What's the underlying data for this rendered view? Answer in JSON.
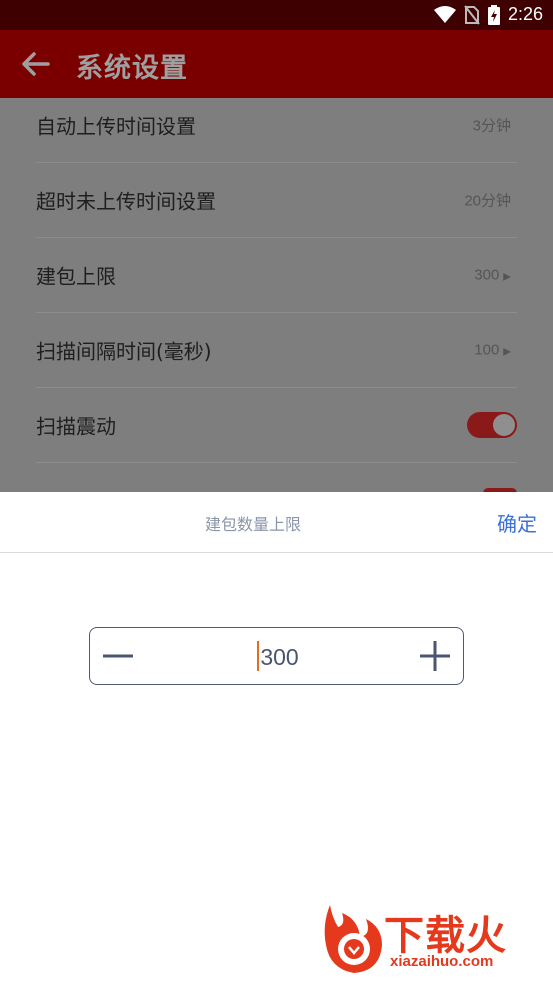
{
  "status_bar": {
    "time": "2:26"
  },
  "app_bar": {
    "title": "系统设置"
  },
  "settings": [
    {
      "label": "自动上传时间设置",
      "value": "3分钟",
      "arrow": false
    },
    {
      "label": "超时未上传时间设置",
      "value": "20分钟",
      "arrow": false
    },
    {
      "label": "建包上限",
      "value": "300",
      "arrow": true
    },
    {
      "label": "扫描间隔时间(毫秒)",
      "value": "100",
      "arrow": true
    },
    {
      "label": "扫描震动",
      "toggle": true
    }
  ],
  "dialog": {
    "title": "建包数量上限",
    "confirm_label": "确定",
    "stepper_value": "300"
  },
  "watermark": {
    "cn": "下载火",
    "en": "xiazaihuo.com"
  },
  "colors": {
    "accent": "#7a0000",
    "link": "#3c72d6",
    "watermark": "#e4391c"
  },
  "icons": {
    "back": "arrow-left-icon",
    "minus": "minus-icon",
    "plus": "plus-icon"
  }
}
